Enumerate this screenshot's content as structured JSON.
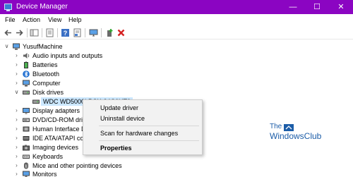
{
  "window": {
    "title": "Device Manager",
    "controls": [
      "minimize-icon",
      "maximize-icon",
      "close-icon"
    ]
  },
  "menu": [
    "File",
    "Action",
    "View",
    "Help"
  ],
  "toolbar": {
    "icons": [
      "back-arrow-icon",
      "forward-arrow-icon",
      "show-hide-tree-icon",
      "properties-icon",
      "help-icon",
      "action-icon",
      "monitor-icon",
      "add-driver-icon",
      "uninstall-x-icon"
    ],
    "accent_delete": "#d42020"
  },
  "tree": {
    "root": "YusufMachine",
    "items": [
      {
        "label": "Audio inputs and outputs",
        "icon": "speaker-icon",
        "expanded": false
      },
      {
        "label": "Batteries",
        "icon": "battery-icon",
        "expanded": false
      },
      {
        "label": "Bluetooth",
        "icon": "bluetooth-icon",
        "expanded": false
      },
      {
        "label": "Computer",
        "icon": "computer-icon",
        "expanded": false
      },
      {
        "label": "Disk drives",
        "icon": "disk-drive-icon",
        "expanded": true
      },
      {
        "label": "WDC WD5000LPCX-24C6HT0",
        "icon": "disk-drive-icon",
        "child": true,
        "selected": true
      },
      {
        "label": "Display adapters",
        "icon": "display-adapter-icon",
        "expanded": false
      },
      {
        "label": "DVD/CD-ROM drives",
        "icon": "dvd-icon",
        "expanded": false
      },
      {
        "label": "Human Interface Devices",
        "icon": "hid-icon",
        "expanded": false
      },
      {
        "label": "IDE ATA/ATAPI controllers",
        "icon": "ide-icon",
        "expanded": false
      },
      {
        "label": "Imaging devices",
        "icon": "camera-icon",
        "expanded": false
      },
      {
        "label": "Keyboards",
        "icon": "keyboard-icon",
        "expanded": false
      },
      {
        "label": "Mice and other pointing devices",
        "icon": "mouse-icon",
        "expanded": false
      },
      {
        "label": "Monitors",
        "icon": "monitor-icon",
        "expanded": false
      }
    ]
  },
  "context_menu": {
    "items": [
      "Update driver",
      "Uninstall device",
      "Scan for hardware changes",
      "Properties"
    ],
    "bold_item": "Properties"
  },
  "watermark": {
    "line1": "The",
    "line2": "WindowsClub"
  },
  "colors": {
    "titlebar": "#8b05c2",
    "selection": "#cce8ff",
    "bluetooth": "#1f6fd1"
  }
}
